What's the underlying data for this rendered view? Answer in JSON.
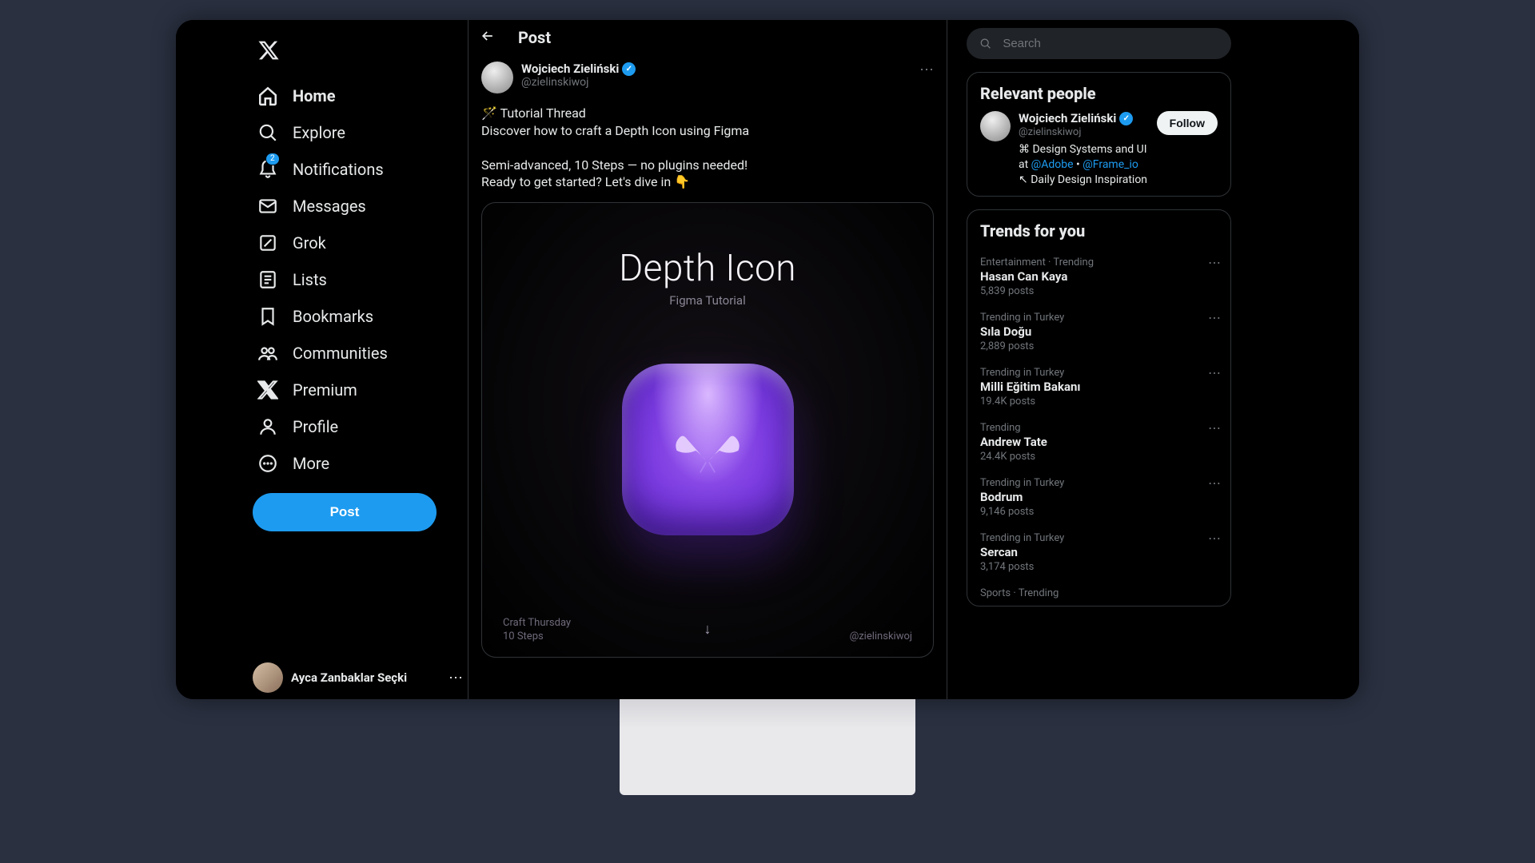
{
  "sidebar": {
    "items": [
      {
        "id": "home",
        "label": "Home"
      },
      {
        "id": "explore",
        "label": "Explore"
      },
      {
        "id": "notifications",
        "label": "Notifications",
        "badge": "2"
      },
      {
        "id": "messages",
        "label": "Messages"
      },
      {
        "id": "grok",
        "label": "Grok"
      },
      {
        "id": "lists",
        "label": "Lists"
      },
      {
        "id": "bookmarks",
        "label": "Bookmarks"
      },
      {
        "id": "communities",
        "label": "Communities"
      },
      {
        "id": "premium",
        "label": "Premium"
      },
      {
        "id": "profile",
        "label": "Profile"
      },
      {
        "id": "more",
        "label": "More"
      }
    ],
    "post_button": "Post",
    "footer_user": "Ayca Zanbaklar Seçki"
  },
  "main": {
    "header_title": "Post",
    "author": {
      "name": "Wojciech Zieliński",
      "handle": "@zielinskiwoj",
      "verified": true
    },
    "body": "🪄 Tutorial Thread\nDiscover how to craft a Depth Icon using Figma\n\nSemi-advanced, 10 Steps — no plugins needed!\nReady to get started? Let's dive in 👇",
    "media": {
      "title": "Depth Icon",
      "subtitle": "Figma Tutorial",
      "footer_left_1": "Craft Thursday",
      "footer_left_2": "10 Steps",
      "footer_right": "@zielinskiwoj"
    }
  },
  "right": {
    "search_placeholder": "Search",
    "relevant_title": "Relevant people",
    "relevant_person": {
      "name": "Wojciech Zieliński",
      "handle": "@zielinskiwoj",
      "bio_prefix": "⌘ Design Systems and UI at ",
      "bio_link1": "@Adobe",
      "bio_dot": " • ",
      "bio_link2": "@Frame_io",
      "bio_suffix": " ↖ Daily Design Inspiration",
      "follow_label": "Follow"
    },
    "trends_title": "Trends for you",
    "trends": [
      {
        "category": "Entertainment · Trending",
        "name": "Hasan Can Kaya",
        "count": "5,839 posts"
      },
      {
        "category": "Trending in Turkey",
        "name": "Sıla Doğu",
        "count": "2,889 posts"
      },
      {
        "category": "Trending in Turkey",
        "name": "Milli Eğitim Bakanı",
        "count": "19.4K posts"
      },
      {
        "category": "Trending",
        "name": "Andrew Tate",
        "count": "24.4K posts"
      },
      {
        "category": "Trending in Turkey",
        "name": "Bodrum",
        "count": "9,146 posts"
      },
      {
        "category": "Trending in Turkey",
        "name": "Sercan",
        "count": "3,174 posts"
      },
      {
        "category": "Sports · Trending",
        "name": "",
        "count": ""
      }
    ]
  }
}
